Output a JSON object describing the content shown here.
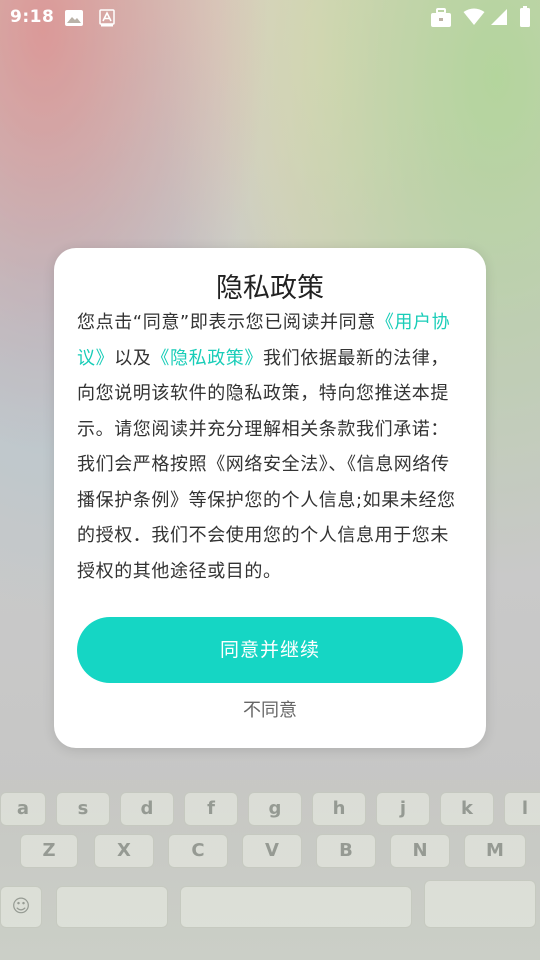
{
  "status_bar": {
    "time": "9:18",
    "icons": [
      "image-icon",
      "a-font-icon",
      "briefcase-icon",
      "wifi-icon",
      "signal-icon",
      "battery-icon"
    ]
  },
  "dialog": {
    "title": "隐私政策",
    "body": {
      "text1": "您点击“同意”即表示您已阅读并同意",
      "link_user_agreement": "《用户协议》",
      "text2": "以及",
      "link_privacy_policy": "《隐私政策》",
      "text3": "我们依据最新的法律，向您说明该软件的隐私政策，特向您推送本提示。请您阅读并充分理解相关条款我们承诺：我们会严格按照《网络安全法》、《信息网络传播保护条例》等保护您的个人信息;如果未经您的授权．我们不会使用您的个人信息用于您未授权的其他途径或目的。"
    },
    "agree_button_label": "同意并继续",
    "disagree_button_label": "不同意"
  },
  "colors": {
    "accent": "#15d6c4",
    "link": "#19cdb8"
  }
}
